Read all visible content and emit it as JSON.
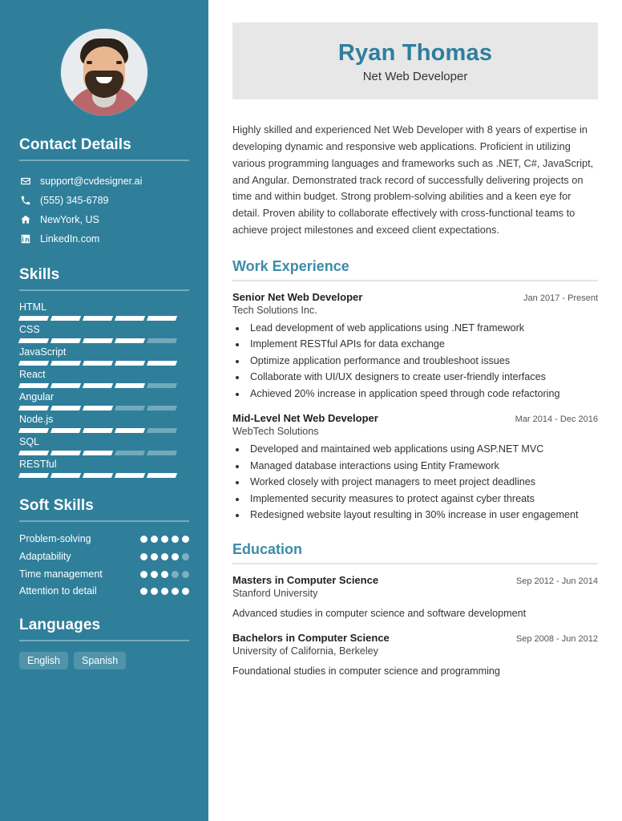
{
  "sidebar": {
    "avatar_alt": "profile-photo",
    "contact": {
      "heading": "Contact Details",
      "items": [
        {
          "icon": "envelope-icon",
          "value": "support@cvdesigner.ai"
        },
        {
          "icon": "phone-icon",
          "value": "(555) 345-6789"
        },
        {
          "icon": "home-icon",
          "value": "NewYork, US"
        },
        {
          "icon": "linkedin-icon",
          "value": "LinkedIn.com"
        }
      ]
    },
    "skills": {
      "heading": "Skills",
      "max": 5,
      "items": [
        {
          "name": "HTML",
          "level": 5
        },
        {
          "name": "CSS",
          "level": 4
        },
        {
          "name": "JavaScript",
          "level": 5
        },
        {
          "name": "React",
          "level": 4
        },
        {
          "name": "Angular",
          "level": 3
        },
        {
          "name": "Node.js",
          "level": 4
        },
        {
          "name": "SQL",
          "level": 3
        },
        {
          "name": "RESTful",
          "level": 5
        }
      ]
    },
    "soft_skills": {
      "heading": "Soft Skills",
      "max": 5,
      "items": [
        {
          "name": "Problem-solving",
          "level": 5
        },
        {
          "name": "Adaptability",
          "level": 4
        },
        {
          "name": "Time management",
          "level": 3
        },
        {
          "name": "Attention to detail",
          "level": 5
        }
      ]
    },
    "languages": {
      "heading": "Languages",
      "items": [
        "English",
        "Spanish"
      ]
    }
  },
  "header": {
    "name": "Ryan Thomas",
    "role": "Net Web Developer"
  },
  "summary": "Highly skilled and experienced Net Web Developer with 8 years of expertise in developing dynamic and responsive web applications. Proficient in utilizing various programming languages and frameworks such as .NET, C#, JavaScript, and Angular. Demonstrated track record of successfully delivering projects on time and within budget. Strong problem-solving abilities and a keen eye for detail. Proven ability to collaborate effectively with cross-functional teams to achieve project milestones and exceed client expectations.",
  "work": {
    "heading": "Work Experience",
    "entries": [
      {
        "title": "Senior Net Web Developer",
        "date": "Jan 2017 - Present",
        "org": "Tech Solutions Inc.",
        "bullets": [
          "Lead development of web applications using .NET framework",
          "Implement RESTful APIs for data exchange",
          "Optimize application performance and troubleshoot issues",
          "Collaborate with UI/UX designers to create user-friendly interfaces",
          "Achieved 20% increase in application speed through code refactoring"
        ]
      },
      {
        "title": "Mid-Level Net Web Developer",
        "date": "Mar 2014 - Dec 2016",
        "org": "WebTech Solutions",
        "bullets": [
          "Developed and maintained web applications using ASP.NET MVC",
          "Managed database interactions using Entity Framework",
          "Worked closely with project managers to meet project deadlines",
          "Implemented security measures to protect against cyber threats",
          "Redesigned website layout resulting in 30% increase in user engagement"
        ]
      }
    ]
  },
  "education": {
    "heading": "Education",
    "entries": [
      {
        "title": "Masters in Computer Science",
        "date": "Sep 2012 - Jun 2014",
        "org": "Stanford University",
        "desc": "Advanced studies in computer science and software development"
      },
      {
        "title": "Bachelors in Computer Science",
        "date": "Sep 2008 - Jun 2012",
        "org": "University of California, Berkeley",
        "desc": "Foundational studies in computer science and programming"
      }
    ]
  },
  "colors": {
    "sidebar_bg": "#2F7F9B",
    "accent": "#3D8BA8",
    "name_color": "#2E7E9E",
    "name_card_bg": "#E7E7E7"
  }
}
